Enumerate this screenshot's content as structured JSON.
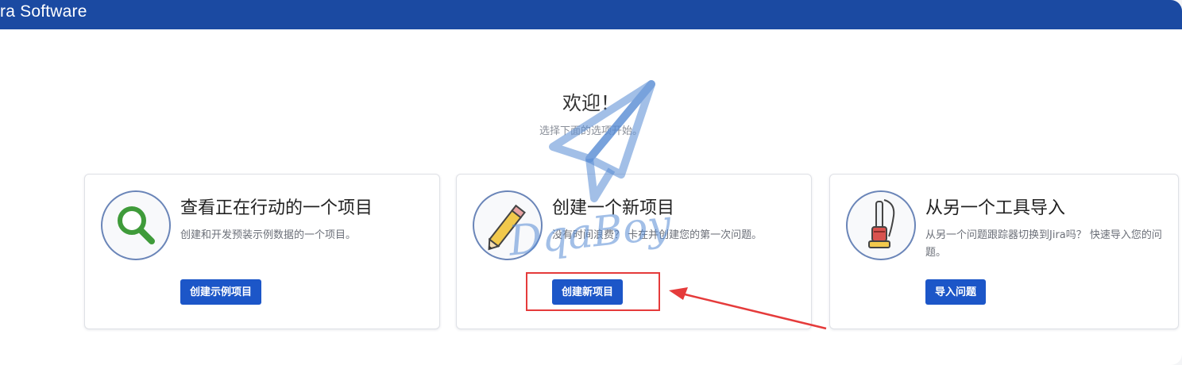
{
  "app": {
    "brand": "ra Software"
  },
  "welcome": {
    "title": "欢迎！",
    "subtitle": "选择下面的选项开始。"
  },
  "cards": [
    {
      "title": "查看正在行动的一个项目",
      "description": "创建和开发预装示例数据的一个项目。",
      "button": "创建示例项目",
      "icon": "magnifier-icon"
    },
    {
      "title": "创建一个新项目",
      "description": "没有时间浪费？ 卡在并创建您的第一次问题。",
      "button": "创建新项目",
      "icon": "pencil-icon"
    },
    {
      "title": "从另一个工具导入",
      "description": "从另一个问题跟踪器切换到Jira吗？ 快速导入您的问题。",
      "button": "导入问题",
      "icon": "vacuum-icon"
    }
  ],
  "watermark": {
    "text": "DqaBoy"
  },
  "colors": {
    "topbar": "#1b4aa2",
    "button": "#1c56c8",
    "highlight": "#e53b3b"
  }
}
